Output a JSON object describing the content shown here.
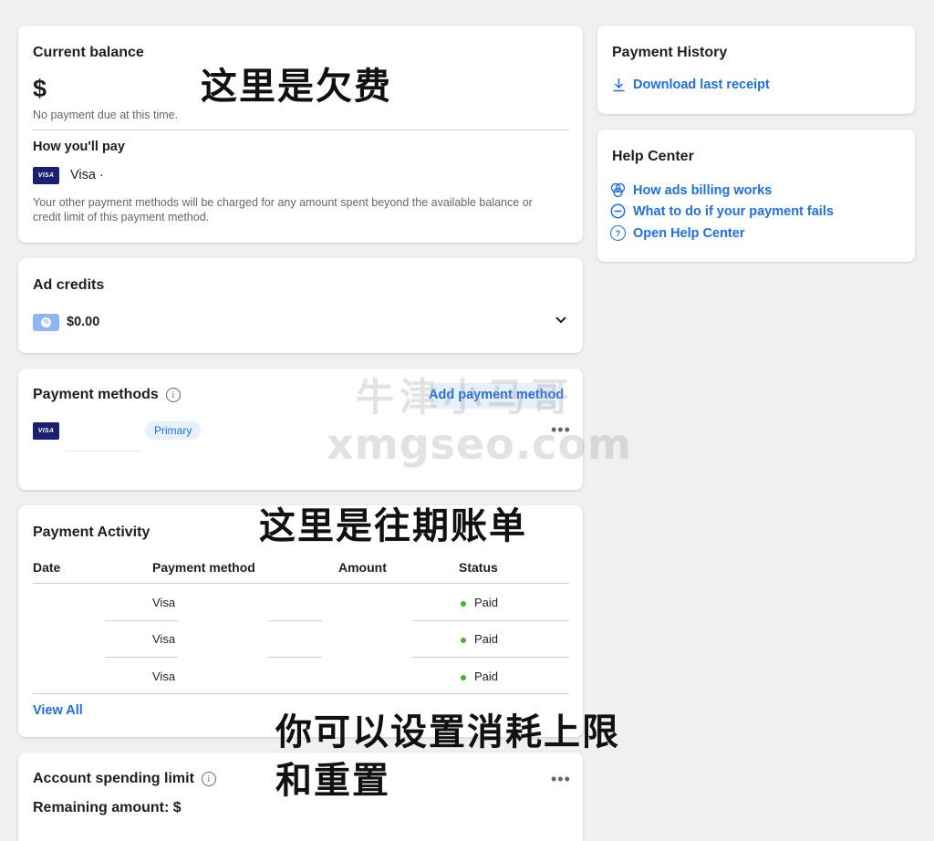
{
  "balance": {
    "title": "Current balance",
    "amount": "$",
    "note": "No payment due at this time.",
    "how_pay_title": "How you'll pay",
    "card_brand": "VISA",
    "card_name": "Visa ·",
    "other_methods_note": "Your other payment methods will be charged for any amount spent beyond the available balance or credit limit of this payment method."
  },
  "ad_credits": {
    "title": "Ad credits",
    "amount": "$0.00"
  },
  "payment_methods": {
    "title": "Payment methods",
    "add_label": "Add payment method",
    "card_brand": "VISA",
    "primary_badge": "Primary",
    "more": "•••"
  },
  "activity": {
    "title": "Payment Activity",
    "columns": [
      "Date",
      "Payment method",
      "Amount",
      "Status"
    ],
    "rows": [
      {
        "method": "Visa",
        "status": "Paid"
      },
      {
        "method": "Visa",
        "status": "Paid"
      },
      {
        "method": "Visa",
        "status": "Paid"
      }
    ],
    "view_all": "View All"
  },
  "spending": {
    "title": "Account spending limit",
    "remaining": "Remaining amount: $",
    "more": "•••"
  },
  "history": {
    "title": "Payment History",
    "download": "Download last receipt"
  },
  "help": {
    "title": "Help Center",
    "links": [
      "How ads billing works",
      "What to do if your payment fails",
      "Open Help Center"
    ]
  },
  "annotations": {
    "debt": "这里是欠费",
    "past_bills": "这里是往期账单",
    "limit_line1": "你可以设置消耗上限",
    "limit_line2": "和重置"
  },
  "watermark": {
    "line1": "牛津小马哥",
    "line2": "xmgseo.com"
  },
  "colors": {
    "accent": "#216fdb",
    "paid": "#42b72a",
    "visa": "#1a1f71"
  }
}
